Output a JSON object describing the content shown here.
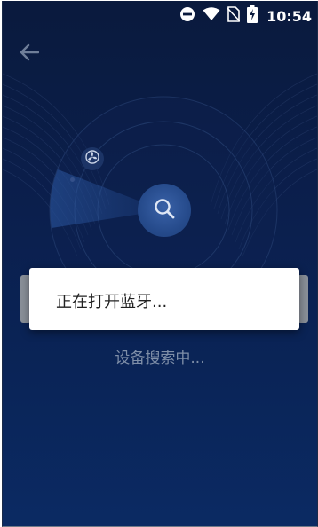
{
  "status_bar": {
    "time": "10:54",
    "icons": [
      "do-not-disturb-icon",
      "wifi-icon",
      "no-sim-icon",
      "battery-charging-icon"
    ]
  },
  "header": {
    "back_icon": "arrow-left-icon"
  },
  "radar": {
    "center_icon": "search-icon",
    "device_icon": "fan-icon"
  },
  "status_text": "设备搜索中...",
  "dialog": {
    "message": "正在打开蓝牙..."
  },
  "colors": {
    "background_top": "#0a1a3d",
    "background_bottom": "#0b2a63",
    "accent": "#264b8c",
    "dialog_bg": "#ffffff"
  }
}
